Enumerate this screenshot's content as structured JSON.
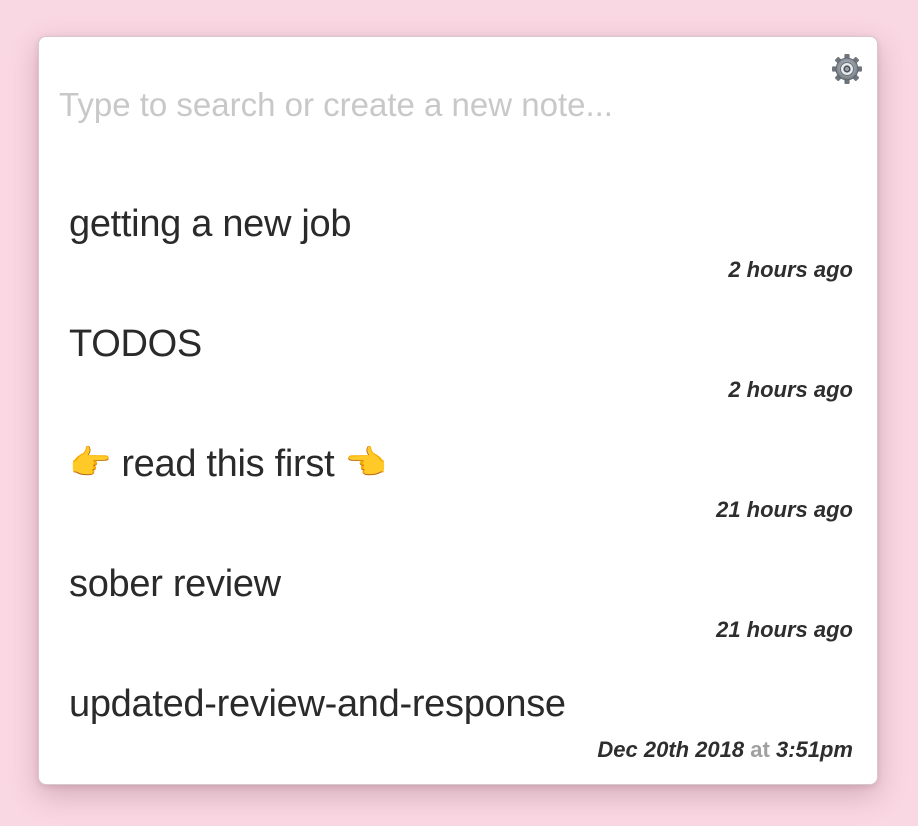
{
  "search": {
    "placeholder": "Type to search or create a new note..."
  },
  "settings": {
    "icon": "gear-icon"
  },
  "notes": [
    {
      "title": "getting a new job",
      "time": "2 hours ago"
    },
    {
      "title": "TODOS",
      "time": "2 hours ago"
    },
    {
      "title": "read this first",
      "emoji_left": "👉",
      "emoji_right": "👈",
      "time": "21 hours ago"
    },
    {
      "title": "sober review",
      "time": "21 hours ago"
    },
    {
      "title": "updated-review-and-response",
      "time_date": "Dec 20th 2018",
      "time_at": "at",
      "time_clock": "3:51pm"
    }
  ],
  "colors": {
    "background": "#f9d7e3",
    "panel": "#ffffff",
    "text": "#2a2a2a",
    "placeholder": "#c8c8c8"
  }
}
